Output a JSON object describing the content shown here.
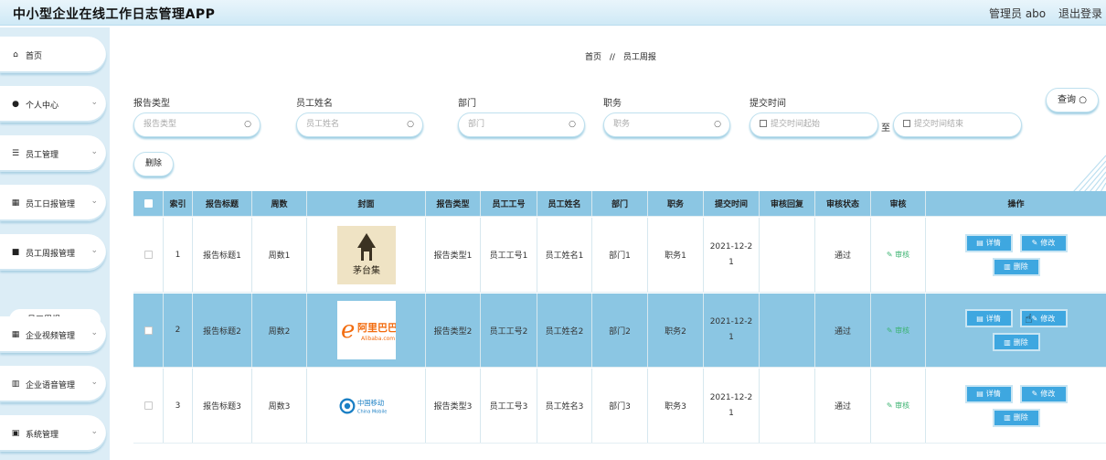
{
  "header": {
    "app_title": "中小型企业在线工作日志管理APP",
    "admin_label": "管理员 abo",
    "logout_label": "退出登录"
  },
  "sidebar": {
    "items": [
      {
        "label": "首页",
        "icon": "home-icon",
        "has_chevron": false
      },
      {
        "label": "个人中心",
        "icon": "user-icon",
        "has_chevron": true
      },
      {
        "label": "员工管理",
        "icon": "sliders-icon",
        "has_chevron": true
      },
      {
        "label": "员工日报管理",
        "icon": "grid-icon",
        "has_chevron": true
      },
      {
        "label": "员工周报管理",
        "icon": "briefcase-icon",
        "has_chevron": true
      },
      {
        "label": "企业视频管理",
        "icon": "grid-icon",
        "has_chevron": true
      },
      {
        "label": "企业语音管理",
        "icon": "bar-chart-icon",
        "has_chevron": true
      },
      {
        "label": "系统管理",
        "icon": "clipboard-icon",
        "has_chevron": true
      }
    ],
    "sub_item": "员工周报"
  },
  "breadcrumb": {
    "home": "首页",
    "separator": "//",
    "current": "员工周报"
  },
  "filters": {
    "report_type": {
      "label": "报告类型",
      "placeholder": "报告类型"
    },
    "employee_name": {
      "label": "员工姓名",
      "placeholder": "员工姓名"
    },
    "department": {
      "label": "部门",
      "placeholder": "部门"
    },
    "position": {
      "label": "职务",
      "placeholder": "职务"
    },
    "submit_time": {
      "label": "提交时间",
      "start_placeholder": "提交时间起始",
      "to": "至",
      "end_placeholder": "提交时间结束"
    },
    "query_label": "查询",
    "delete_label": "删除"
  },
  "table": {
    "columns": [
      "索引",
      "报告标题",
      "周数",
      "封面",
      "报告类型",
      "员工工号",
      "员工姓名",
      "部门",
      "职务",
      "提交时间",
      "审核回复",
      "审核状态",
      "审核",
      "操作"
    ],
    "actions": {
      "detail": "详情",
      "edit": "修改",
      "delete": "删除"
    },
    "rows": [
      {
        "index": "1",
        "title": "报告标题1",
        "week": "周数1",
        "cover": "book-cover-logo",
        "type": "报告类型1",
        "emp_no": "员工工号1",
        "emp_name": "员工姓名1",
        "dept": "部门1",
        "position": "职务1",
        "submit_time": "2021-12-21",
        "reply": "",
        "status": "通过",
        "review": "审核"
      },
      {
        "index": "2",
        "title": "报告标题2",
        "week": "周数2",
        "cover": "alibaba-logo",
        "type": "报告类型2",
        "emp_no": "员工工号2",
        "emp_name": "员工姓名2",
        "dept": "部门2",
        "position": "职务2",
        "submit_time": "2021-12-21",
        "reply": "",
        "status": "通过",
        "review": "审核"
      },
      {
        "index": "3",
        "title": "报告标题3",
        "week": "周数3",
        "cover": "china-mobile-logo",
        "type": "报告类型3",
        "emp_no": "员工工号3",
        "emp_name": "员工姓名3",
        "dept": "部门3",
        "position": "职务3",
        "submit_time": "2021-12-21",
        "reply": "",
        "status": "通过",
        "review": "审核"
      }
    ]
  },
  "cover_text": {
    "book": "茅台集",
    "alibaba_brand": "阿里巴巴",
    "alibaba_en": "Alibaba.com",
    "china_mobile_cn": "中国移动",
    "china_mobile_en": "China Mobile"
  },
  "colors": {
    "accent": "#3ea7e0",
    "header_row": "#8bc6e3",
    "review_green": "#3cb371"
  }
}
